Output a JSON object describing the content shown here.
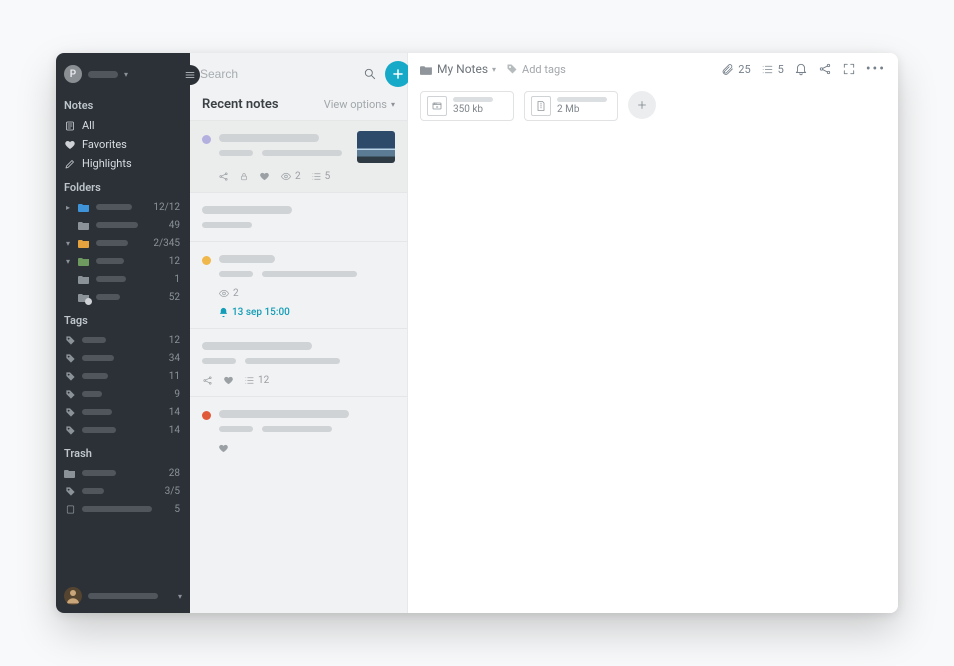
{
  "user": {
    "initial": "P"
  },
  "sidebar": {
    "sections": {
      "notes_title": "Notes",
      "folders_title": "Folders",
      "tags_title": "Tags",
      "trash_title": "Trash"
    },
    "nav": [
      {
        "label": "All",
        "icon": "note"
      },
      {
        "label": "Favorites",
        "icon": "heart"
      },
      {
        "label": "Highlights",
        "icon": "pencil"
      }
    ],
    "folders": [
      {
        "count": "12/12",
        "icon_color": "#3f93d8"
      },
      {
        "count": "49",
        "icon_color": "#8b9298"
      },
      {
        "count": "2/345",
        "icon_color": "#e6a23c"
      },
      {
        "count": "12",
        "icon_color": "#5f8c4e",
        "indent": 1
      },
      {
        "count": "1",
        "icon_color": "#8b9298",
        "indent": 2
      },
      {
        "count": "52",
        "icon_color": "#8b9298",
        "indent": 1,
        "badge": true
      }
    ],
    "tags": [
      {
        "count": "12"
      },
      {
        "count": "34"
      },
      {
        "count": "11"
      },
      {
        "count": "9"
      },
      {
        "count": "14"
      },
      {
        "count": "14"
      }
    ],
    "trash": [
      {
        "icon": "folder",
        "count": "28"
      },
      {
        "icon": "tag",
        "count": "3/5"
      },
      {
        "icon": "note",
        "count": "5"
      }
    ]
  },
  "search": {
    "placeholder": "Search"
  },
  "list": {
    "title": "Recent notes",
    "view_options": "View options",
    "cards": [
      {
        "dot": "#b3b0e0",
        "has_thumb": true,
        "meta": [
          {
            "icon": "share"
          },
          {
            "icon": "lock"
          },
          {
            "icon": "heart"
          },
          {
            "icon": "eye",
            "text": "2"
          },
          {
            "icon": "list",
            "text": "5"
          }
        ]
      },
      {
        "plain": true
      },
      {
        "dot": "#f0b74a",
        "sub": [
          {
            "icon": "eye",
            "text": "2"
          }
        ],
        "reminder": {
          "icon": "bell",
          "text": "13 sep 15:00"
        }
      },
      {
        "plain": true,
        "meta": [
          {
            "icon": "share"
          },
          {
            "icon": "heart"
          },
          {
            "icon": "list",
            "text": "12"
          }
        ]
      },
      {
        "dot": "#e05a3a",
        "meta": [
          {
            "icon": "heart"
          }
        ]
      }
    ]
  },
  "detail": {
    "breadcrumb": "My Notes",
    "add_tags": "Add tags",
    "attachments_count": "25",
    "tasks_count": "5",
    "attachments": [
      {
        "type": "video",
        "size": "350 kb"
      },
      {
        "type": "archive",
        "size": "2 Mb"
      }
    ]
  }
}
